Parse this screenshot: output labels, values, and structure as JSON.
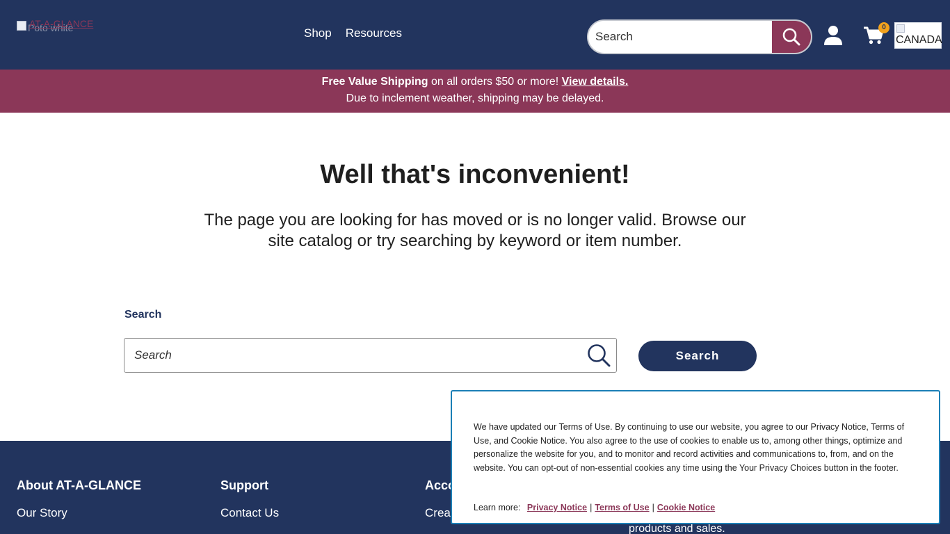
{
  "header": {
    "logo_alt_text": "AT-A-GLANCE",
    "logo_alt_secondary": "Poto white",
    "nav": [
      {
        "label": "Shop"
      },
      {
        "label": "Resources"
      }
    ],
    "search": {
      "placeholder": "Search"
    },
    "cart_count": "0",
    "country_label": "CANADA"
  },
  "promo": {
    "strong_text": "Free Value Shipping",
    "text": " on all orders $50 or more! ",
    "link": "View details.",
    "line2": "Due to inclement weather, shipping may be delayed."
  },
  "main": {
    "title": "Well that's inconvenient!",
    "description": "The page you are looking for has moved or is no longer valid. Browse our site catalog or try searching by keyword or item number.",
    "search_label": "Search",
    "search_placeholder": "Search",
    "search_button": "Search"
  },
  "footer": {
    "columns": [
      {
        "heading": "About AT-A-GLANCE",
        "item": "Our Story"
      },
      {
        "heading": "Support",
        "item": "Contact Us"
      },
      {
        "heading": "Acco",
        "item": "Creat"
      }
    ],
    "extra_text": "products and sales."
  },
  "cookie": {
    "text": "We have updated our Terms of Use. By continuing to use our website, you agree to our Privacy Notice, Terms of Use, and Cookie Notice. You also agree to the use of cookies to enable us to, among other things, optimize and personalize the website for you, and to monitor and record activities and communications to, from, and on the website. You can opt-out of non-essential cookies any time using the Your Privacy Choices button in the footer.",
    "learn_more": "Learn more:",
    "links": [
      "Privacy Notice",
      "Terms of Use",
      "Cookie Notice"
    ],
    "separator": "|"
  },
  "colors": {
    "navy": "#22345e",
    "plum": "#8b3758",
    "badge": "#f3a21c",
    "banner_border": "#1b7fb6"
  },
  "icons": [
    "search-icon",
    "user-icon",
    "cart-icon",
    "magnifier-icon"
  ]
}
